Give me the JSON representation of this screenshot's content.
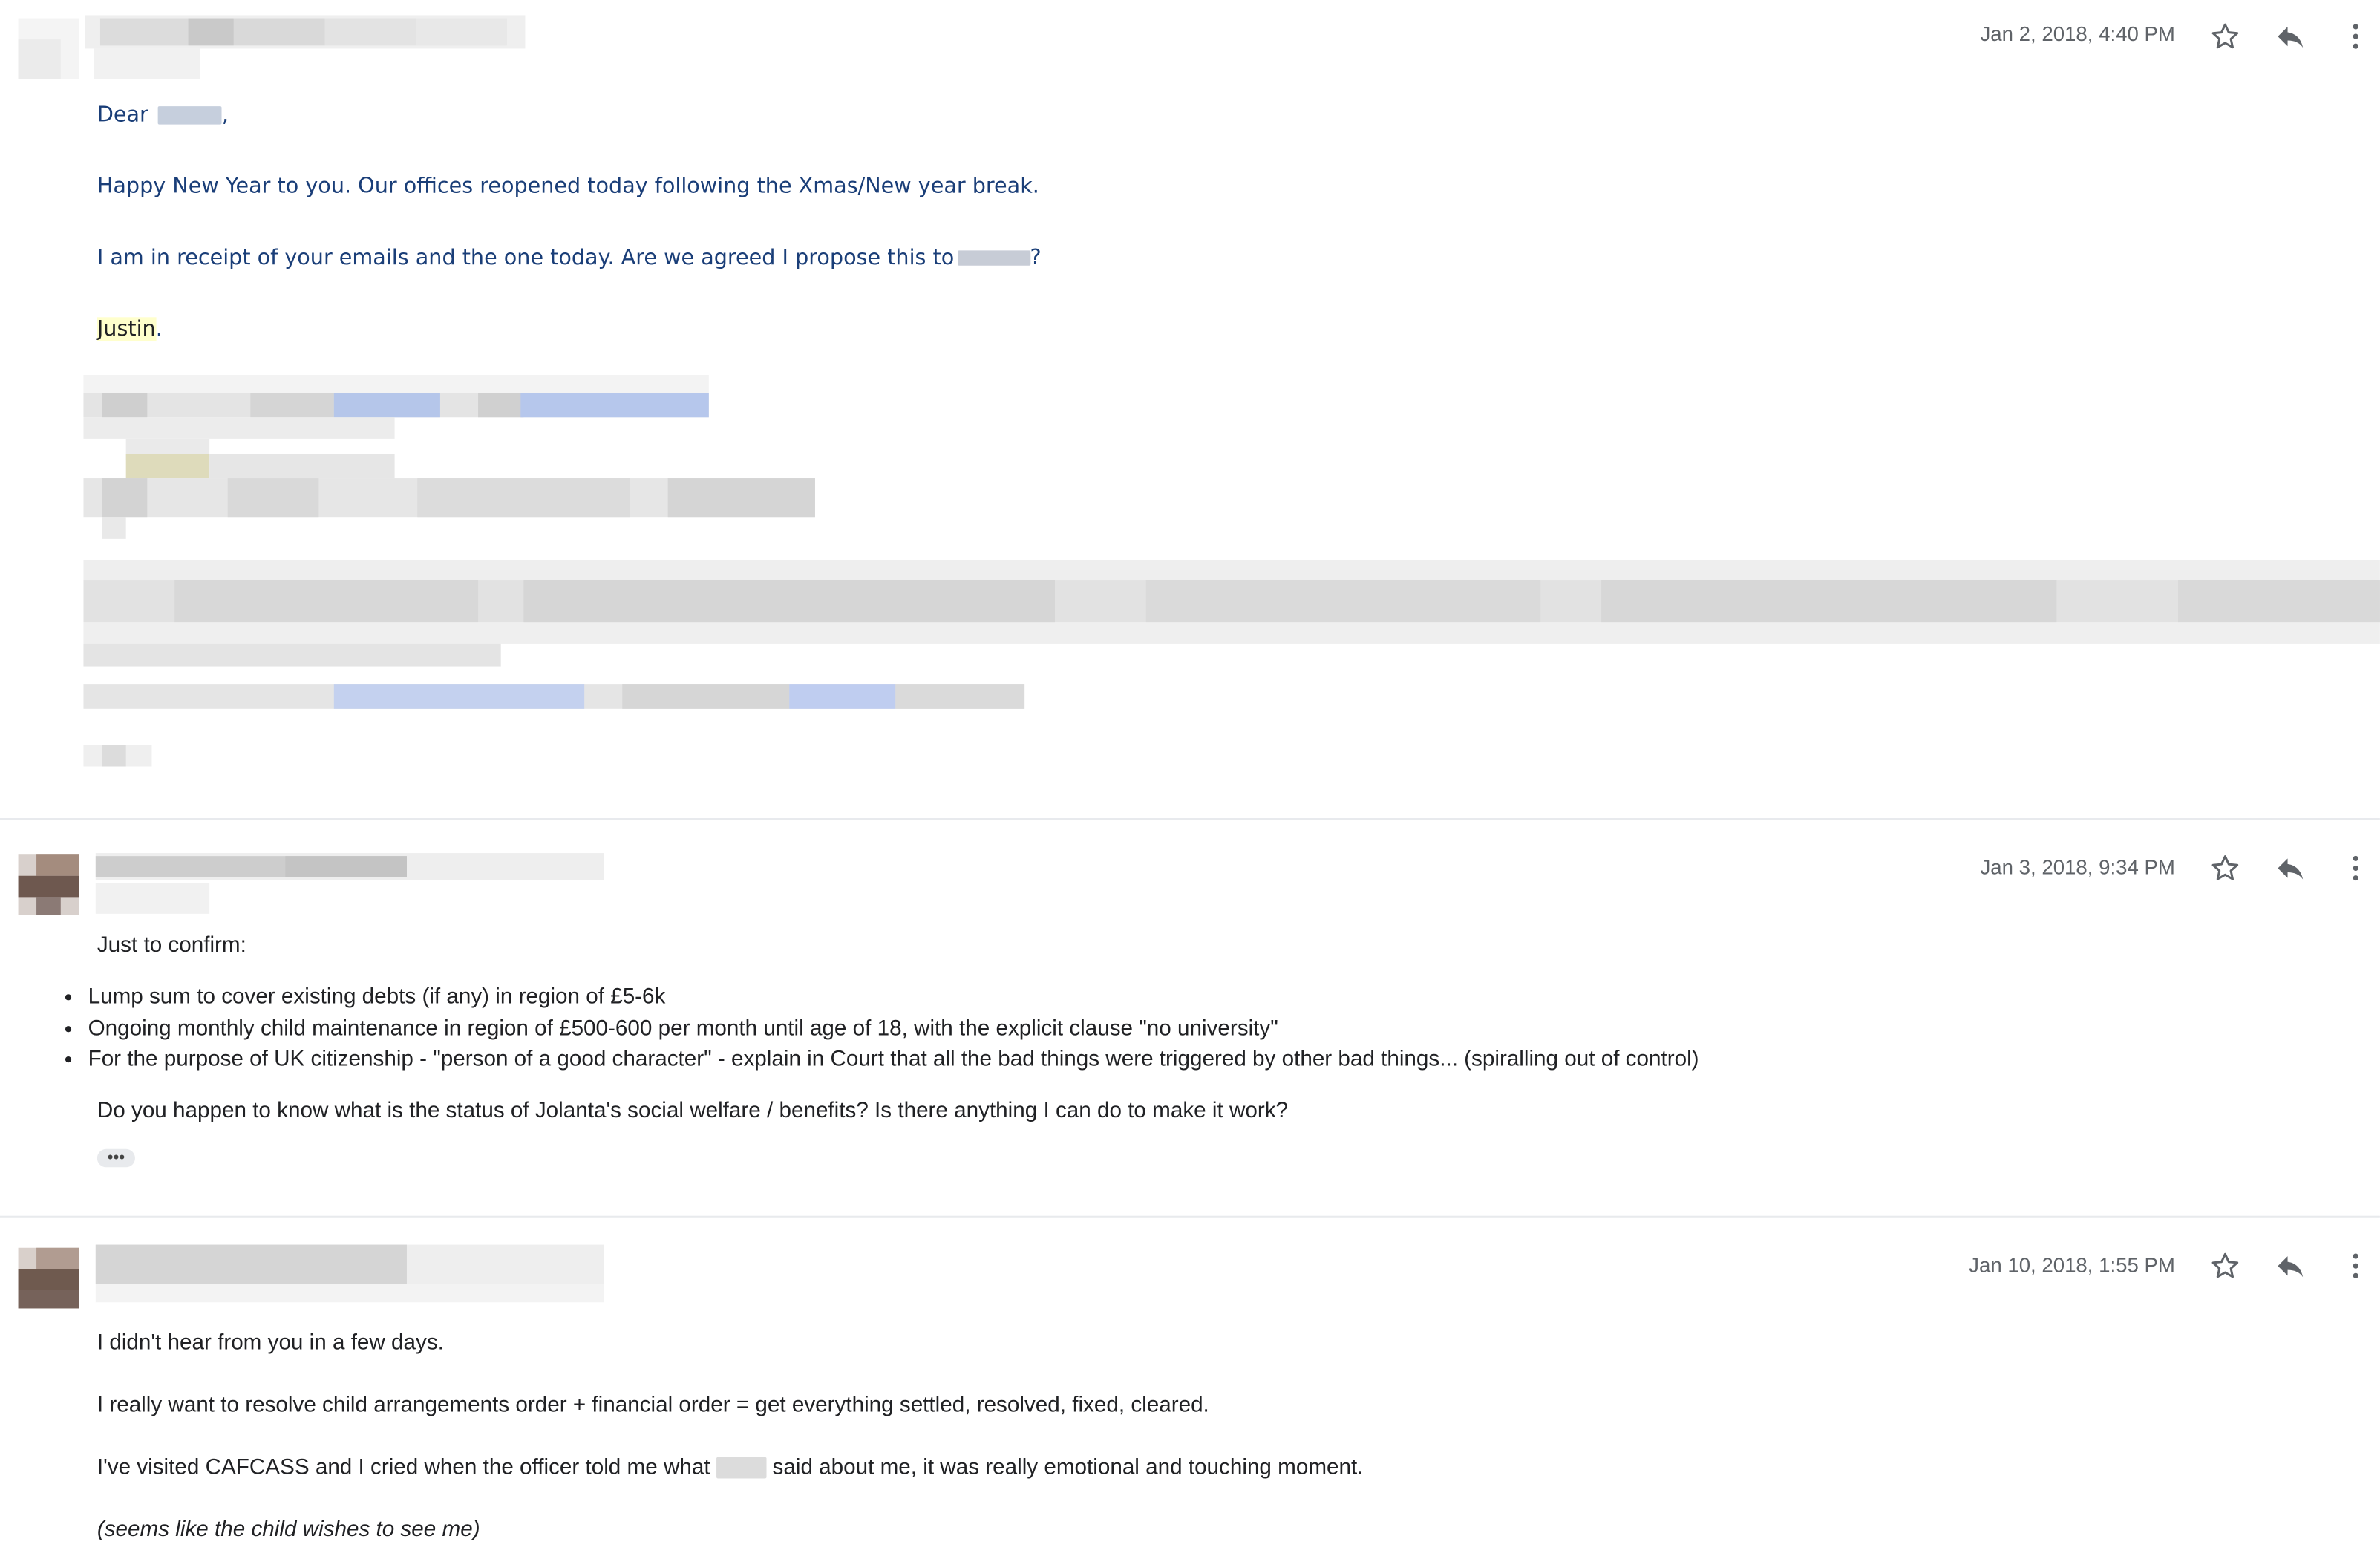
{
  "messages": [
    {
      "date": "Jan 2, 2018, 4:40 PM",
      "greeting_prefix": "Dear",
      "greeting_suffix": ",",
      "para1": "Happy New Year to you. Our offices reopened today following the Xmas/New year break.",
      "para2_prefix": "I am in receipt of your emails and the one today.  Are we agreed  I propose this to",
      "para2_suffix": "?",
      "signature_name": "Justin",
      "signature_suffix": "."
    },
    {
      "date": "Jan 3, 2018, 9:34 PM",
      "intro": "Just to confirm:",
      "bullets": [
        "Lump sum to cover existing debts (if any) in region of £5-6k",
        "Ongoing monthly child maintenance in region of £500-600 per month until age of 18, with the explicit clause \"no university\"",
        "For the purpose of UK citizenship - \"person of a good character\" - explain in Court that all the bad things were triggered by other bad things... (spiralling out of control)"
      ],
      "question": "Do you happen to know what is the status of Jolanta's social welfare / benefits? Is there anything I can do to make it work?",
      "ellipsis": "•••"
    },
    {
      "date": "Jan 10, 2018, 1:55 PM",
      "para1": "I didn't hear from you in a few days.",
      "para2": "I really want to resolve child arrangements order + financial order = get everything settled, resolved, fixed, cleared.",
      "para3_prefix": "I've visited CAFCASS and I cried when the officer told me what",
      "para3_suffix": "said about me, it was really emotional and touching moment.",
      "para4": "(seems like the child wishes to see me)"
    }
  ],
  "icons": {
    "star": "star-outline-icon",
    "reply": "reply-arrow-icon",
    "more": "more-vertical-icon"
  },
  "colors": {
    "body_blue": "#1a3e78",
    "highlight": "#ffffcc",
    "meta_gray": "#5f6368",
    "divider": "#e8eaed"
  }
}
